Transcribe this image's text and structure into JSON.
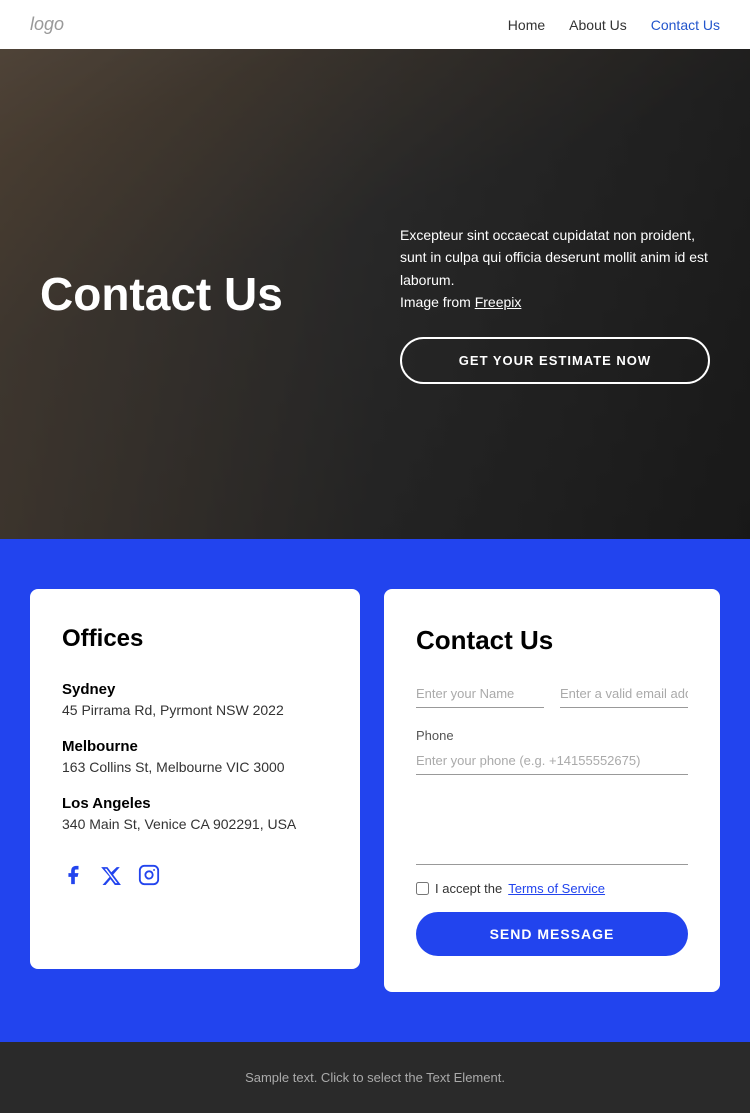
{
  "nav": {
    "logo": "logo",
    "links": [
      {
        "label": "Home",
        "active": false
      },
      {
        "label": "About Us",
        "active": false
      },
      {
        "label": "Contact Us",
        "active": true
      }
    ]
  },
  "hero": {
    "title": "Contact Us",
    "description": "Excepteur sint occaecat cupidatat non proident, sunt in culpa qui officia deserunt mollit anim id est laborum.",
    "image_credit_prefix": "Image from ",
    "image_credit_link": "Freepix",
    "cta_button": "GET YOUR ESTIMATE NOW"
  },
  "offices": {
    "title": "Offices",
    "locations": [
      {
        "name": "Sydney",
        "address": "45 Pirrama Rd, Pyrmont NSW 2022"
      },
      {
        "name": "Melbourne",
        "address": "163 Collins St, Melbourne VIC 3000"
      },
      {
        "name": "Los Angeles",
        "address": "340 Main St, Venice CA 902291, USA"
      }
    ],
    "social": {
      "facebook": "f",
      "twitter": "𝕏",
      "instagram": "ig"
    }
  },
  "contact_form": {
    "title": "Contact Us",
    "name_placeholder": "Enter your Name",
    "email_placeholder": "Enter a valid email address",
    "phone_label": "Phone",
    "phone_placeholder": "Enter your phone (e.g. +14155552675)",
    "checkbox_text": "I accept the ",
    "terms_link": "Terms of Service",
    "send_button": "SEND MESSAGE"
  },
  "footer": {
    "text": "Sample text. Click to select the Text Element."
  }
}
